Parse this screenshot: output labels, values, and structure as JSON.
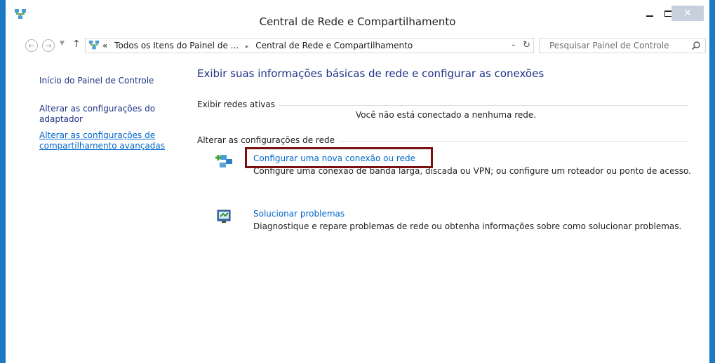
{
  "window": {
    "title": "Central de Rede e Compartilhamento",
    "accent_color": "#1c79c4",
    "app_icon": "network-icon"
  },
  "navigation": {
    "back_icon": "back-arrow-icon",
    "forward_icon": "forward-arrow-icon",
    "up_icon": "up-arrow-icon",
    "address": {
      "overflow": "«",
      "crumb1": "Todos os Itens do Painel de ...",
      "separator": "▸",
      "crumb2": "Central de Rede e Compartilhamento"
    },
    "search_placeholder": "Pesquisar Painel de Controle"
  },
  "sidebar": {
    "home": "Início do Painel de Controle",
    "adapter_line1": "Alterar as configurações do",
    "adapter_line2": "adaptador",
    "advanced_line1": "Alterar as configurações de",
    "advanced_line2": "compartilhamento avançadas",
    "link_color": "#0066cc"
  },
  "main": {
    "heading": "Exibir suas informações básicas de rede e configurar as conexões",
    "active_networks_label": "Exibir redes ativas",
    "no_network_message": "Você não está conectado a nenhuma rede.",
    "change_settings_label": "Alterar as configurações de rede",
    "tasks": [
      {
        "link": "Configurar uma nova conexão ou rede",
        "description": "Configure uma conexão de banda larga, discada ou VPN; ou configure um roteador ou ponto de acesso.",
        "icon": "new-connection-icon"
      },
      {
        "link": "Solucionar problemas",
        "description": "Diagnostique e repare problemas de rede ou obtenha informações sobre como solucionar problemas.",
        "icon": "troubleshoot-icon"
      }
    ],
    "highlight_color": "#7a1010"
  }
}
